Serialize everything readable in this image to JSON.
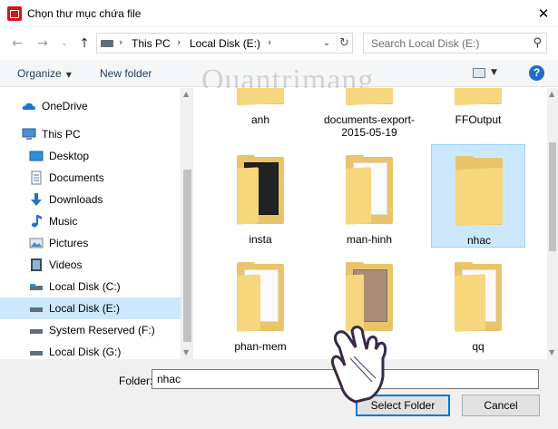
{
  "window": {
    "title": "Chọn thư mục chứa file"
  },
  "address": {
    "segments": [
      "This PC",
      "Local Disk (E:)"
    ],
    "search_placeholder": "Search Local Disk (E:)"
  },
  "toolbar": {
    "organize_label": "Organize",
    "new_folder_label": "New folder"
  },
  "watermark": "Quantrimang",
  "sidebar": {
    "items": [
      {
        "label": "OneDrive",
        "icon": "cloud-icon",
        "indent": 0,
        "state": ""
      },
      {
        "label": "This PC",
        "icon": "computer-icon",
        "indent": 0,
        "state": ""
      },
      {
        "label": "Desktop",
        "icon": "desktop-icon",
        "indent": 1,
        "state": ""
      },
      {
        "label": "Documents",
        "icon": "documents-icon",
        "indent": 1,
        "state": ""
      },
      {
        "label": "Downloads",
        "icon": "download-icon",
        "indent": 1,
        "state": ""
      },
      {
        "label": "Music",
        "icon": "music-icon",
        "indent": 1,
        "state": ""
      },
      {
        "label": "Pictures",
        "icon": "pictures-icon",
        "indent": 1,
        "state": ""
      },
      {
        "label": "Videos",
        "icon": "videos-icon",
        "indent": 1,
        "state": ""
      },
      {
        "label": "Local Disk (C:)",
        "icon": "drive-icon",
        "indent": 1,
        "state": ""
      },
      {
        "label": "Local Disk (E:)",
        "icon": "drive-icon",
        "indent": 1,
        "state": "selected"
      },
      {
        "label": "System Reserved (F:)",
        "icon": "drive-icon",
        "indent": 1,
        "state": ""
      },
      {
        "label": "Local Disk (G:)",
        "icon": "drive-icon",
        "indent": 1,
        "state": ""
      }
    ]
  },
  "folders": [
    {
      "label": "anh",
      "selected": false
    },
    {
      "label": "documents-export-2015-05-19",
      "selected": false
    },
    {
      "label": "FFOutput",
      "selected": false
    },
    {
      "label": "insta",
      "selected": false
    },
    {
      "label": "man-hinh",
      "selected": false
    },
    {
      "label": "nhac",
      "selected": true
    },
    {
      "label": "phan-mem",
      "selected": false
    },
    {
      "label": "",
      "selected": false
    },
    {
      "label": "qq",
      "selected": false
    }
  ],
  "footer": {
    "folder_label": "Folder:",
    "folder_value": "nhac",
    "select_button": "Select Folder",
    "cancel_button": "Cancel"
  },
  "colors": {
    "selection": "#cce8ff",
    "accent": "#0078d7",
    "folder": "#f6d77e"
  }
}
